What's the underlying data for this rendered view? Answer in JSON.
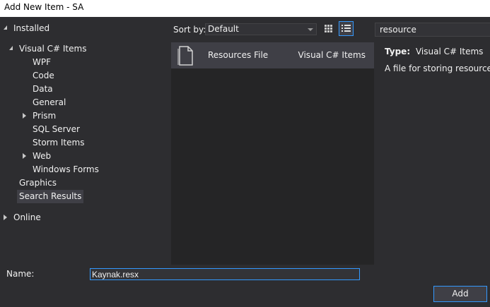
{
  "window": {
    "title": "Add New Item - SA"
  },
  "tree": {
    "installed": "Installed",
    "visual_csharp": "Visual C# Items",
    "wpf": "WPF",
    "code": "Code",
    "data": "Data",
    "general": "General",
    "prism": "Prism",
    "sql_server": "SQL Server",
    "storm_items": "Storm Items",
    "web": "Web",
    "windows_forms": "Windows Forms",
    "graphics": "Graphics",
    "search_results": "Search Results",
    "online": "Online"
  },
  "toolbar": {
    "sort_label": "Sort by:",
    "sort_value": "Default"
  },
  "search": {
    "value": "resource"
  },
  "templates": [
    {
      "name": "Resources File",
      "category": "Visual C# Items"
    }
  ],
  "details": {
    "type_label": "Type:",
    "type_value": "Visual C# Items",
    "description": "A file for storing resources"
  },
  "footer": {
    "name_label": "Name:",
    "name_value": "Kaynak.resx",
    "add_label": "Add"
  }
}
